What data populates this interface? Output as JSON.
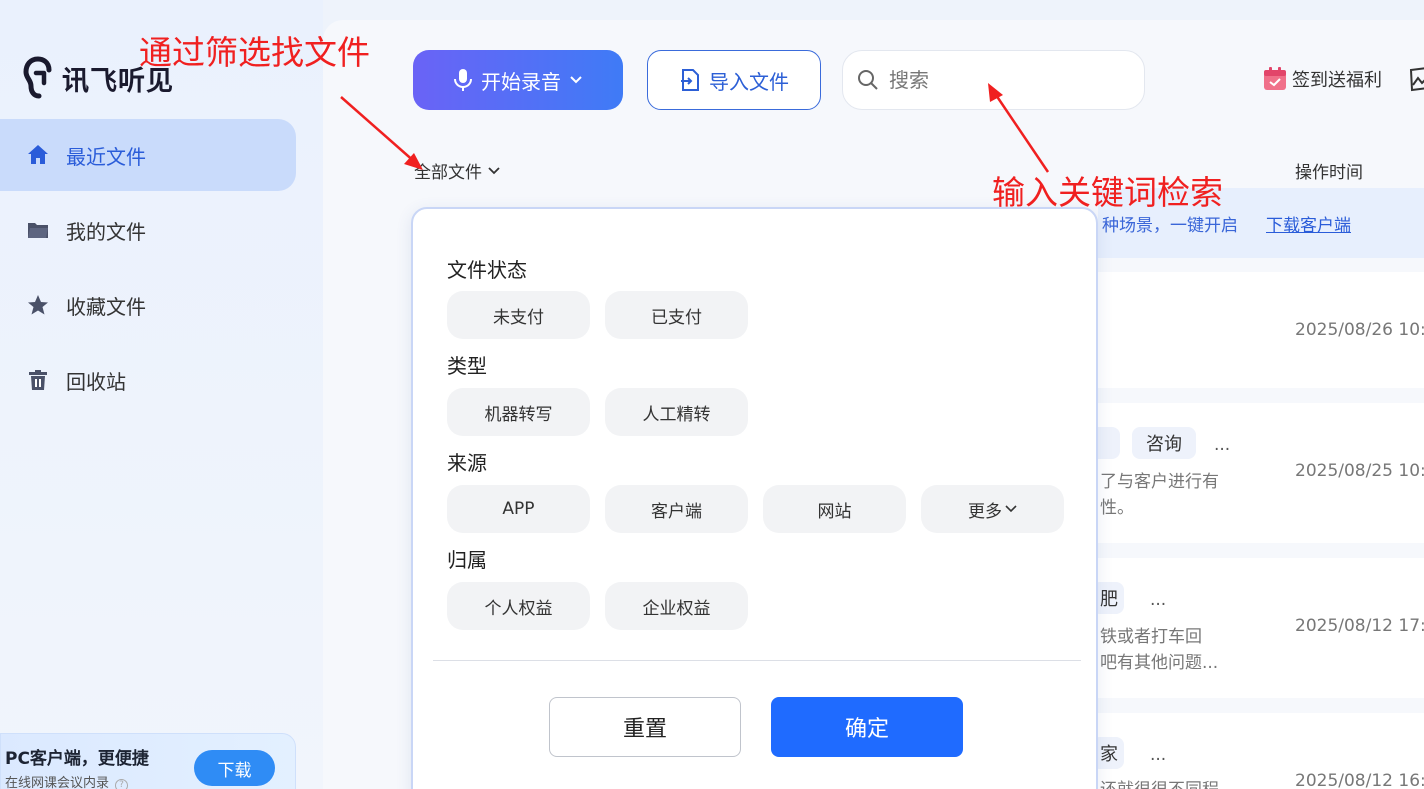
{
  "app": {
    "name": "讯飞听见"
  },
  "sidebar": {
    "items": [
      {
        "label": "最近文件",
        "icon": "home-icon",
        "active": true
      },
      {
        "label": "我的文件",
        "icon": "folder-icon",
        "active": false
      },
      {
        "label": "收藏文件",
        "icon": "star-icon",
        "active": false
      },
      {
        "label": "回收站",
        "icon": "trash-icon",
        "active": false
      }
    ],
    "promo": {
      "title": "PC客户端，更便捷",
      "subtitle": "在线网课会议内录",
      "help": "?",
      "button": "下载"
    }
  },
  "toolbar": {
    "record_label": "开始录音",
    "import_label": "导入文件",
    "search_placeholder": "搜索",
    "checkin_label": "签到送福利"
  },
  "list": {
    "filter_label": "全部文件",
    "time_header": "操作时间",
    "banner": {
      "text": "种场景，一键开启",
      "link": "下载客户端"
    },
    "rows": [
      {
        "time": "2025/08/26 10:"
      },
      {
        "tags": [
          "",
          "咨询"
        ],
        "more": "...",
        "desc": [
          "了与客户进行有",
          "性。"
        ],
        "time": "2025/08/25 10:"
      },
      {
        "tags": [
          "肥"
        ],
        "more": "...",
        "desc": [
          "铁或者打车回",
          "吧有其他问题..."
        ],
        "time": "2025/08/12 17:"
      },
      {
        "tags": [
          "家"
        ],
        "more": "...",
        "desc": [
          "还就很很不同程"
        ],
        "time": "2025/08/12 16:"
      }
    ]
  },
  "filter_panel": {
    "groups": [
      {
        "title": "文件状态",
        "options": [
          "未支付",
          "已支付"
        ]
      },
      {
        "title": "类型",
        "options": [
          "机器转写",
          "人工精转"
        ]
      },
      {
        "title": "来源",
        "options": [
          "APP",
          "客户端",
          "网站",
          "更多"
        ]
      },
      {
        "title": "归属",
        "options": [
          "个人权益",
          "企业权益"
        ]
      }
    ],
    "reset_label": "重置",
    "confirm_label": "确定"
  },
  "annotations": {
    "filter_note": "通过筛选找文件",
    "search_note": "输入关键词检索",
    "color": "#f02020"
  },
  "colors": {
    "accent": "#1f6bff",
    "nav_active_bg": "#c9dbfb"
  }
}
